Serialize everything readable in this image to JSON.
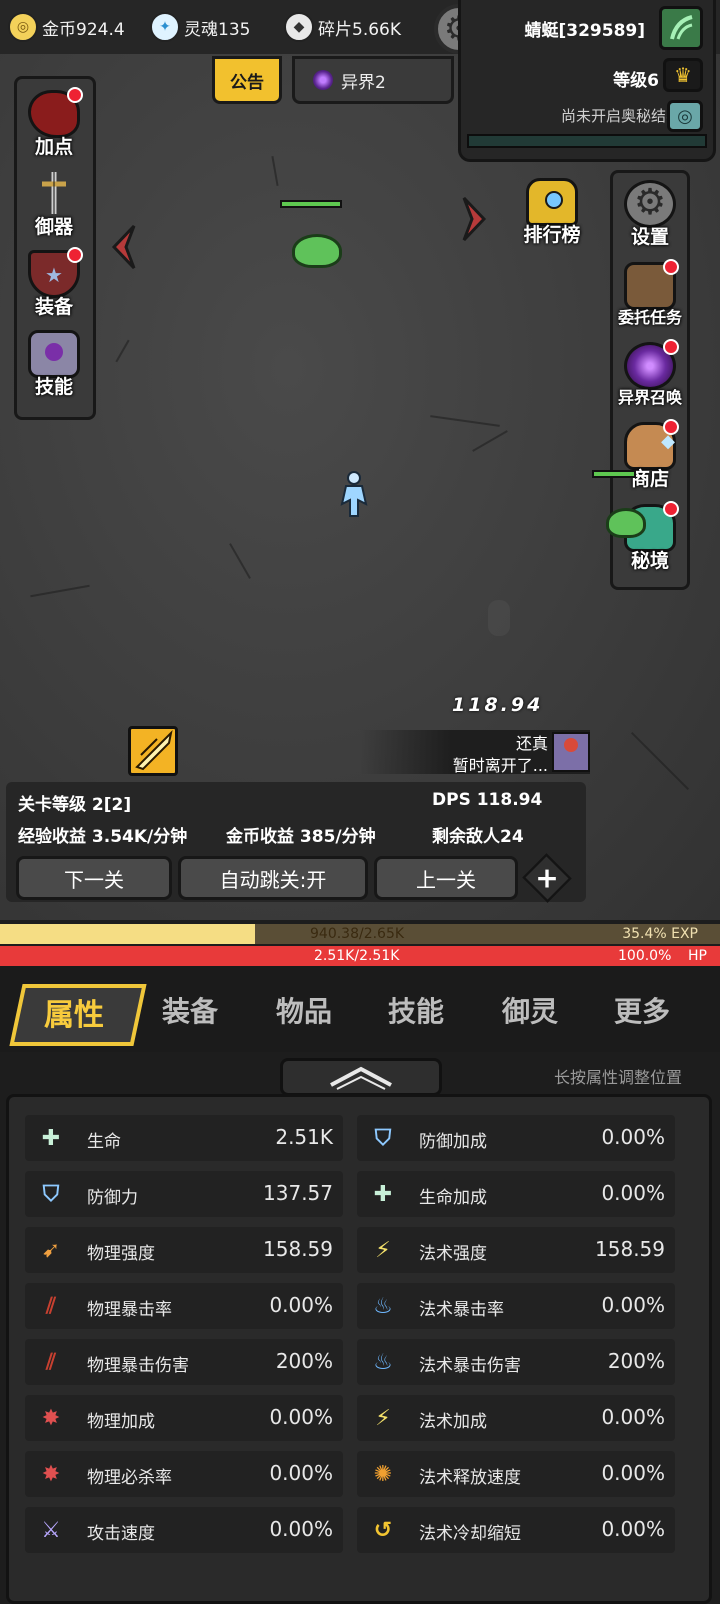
{
  "resources": {
    "gold": "金币924.4",
    "soul": "灵魂135",
    "shards": "碎片5.66K"
  },
  "player": {
    "name": "蜻蜓[329589]",
    "level": "等级6",
    "secret_realm_status": "尚未开启奥秘结界"
  },
  "tabs_top": {
    "notice": "公告",
    "realm": "异界2"
  },
  "left_menu": [
    {
      "label": "加点"
    },
    {
      "label": "御器"
    },
    {
      "label": "装备"
    },
    {
      "label": "技能"
    }
  ],
  "right_top_menu": [
    {
      "label": "排行榜"
    },
    {
      "label": "设置"
    }
  ],
  "right_menu": [
    {
      "label": "委托任务"
    },
    {
      "label": "异界召唤"
    },
    {
      "label": "商店"
    },
    {
      "label": "秘境"
    }
  ],
  "battle": {
    "damage_number": "118.94",
    "chat_name": "还真",
    "chat_message": "暂时离开了..."
  },
  "stage": {
    "level": "关卡等级 2[2]",
    "dps": "DPS 118.94",
    "exp_income": "经验收益 3.54K/分钟",
    "gold_income": "金币收益 385/分钟",
    "enemies_left": "剩余敌人24",
    "next_btn": "下一关",
    "auto_btn": "自动跳关:开",
    "prev_btn": "上一关",
    "plus": "+"
  },
  "bars": {
    "exp_text": "940.38/2.65K",
    "exp_percent": "35.4% EXP",
    "exp_fraction": 0.354,
    "hp_text": "2.51K/2.51K",
    "hp_percent": "100.0%",
    "hp_label": "HP"
  },
  "bottom_tabs": [
    "属性",
    "装备",
    "物品",
    "技能",
    "御灵",
    "更多"
  ],
  "attr_hint": "长按属性调整位置",
  "attributes_left": [
    {
      "icon": "plus-icon",
      "name": "生命",
      "value": "2.51K"
    },
    {
      "icon": "shield-icon",
      "name": "防御力",
      "value": "137.57"
    },
    {
      "icon": "blade-icon",
      "name": "物理强度",
      "value": "158.59"
    },
    {
      "icon": "claw-icon",
      "name": "物理暴击率",
      "value": "0.00%"
    },
    {
      "icon": "claw-icon",
      "name": "物理暴击伤害",
      "value": "200%"
    },
    {
      "icon": "burst-icon",
      "name": "物理加成",
      "value": "0.00%"
    },
    {
      "icon": "burst-icon",
      "name": "物理必杀率",
      "value": "0.00%"
    },
    {
      "icon": "sword-icon",
      "name": "攻击速度",
      "value": "0.00%"
    }
  ],
  "attributes_right": [
    {
      "icon": "shield-icon",
      "name": "防御加成",
      "value": "0.00%"
    },
    {
      "icon": "plus-icon",
      "name": "生命加成",
      "value": "0.00%"
    },
    {
      "icon": "lightning-icon",
      "name": "法术强度",
      "value": "158.59"
    },
    {
      "icon": "flame-icon",
      "name": "法术暴击率",
      "value": "0.00%"
    },
    {
      "icon": "flame-icon",
      "name": "法术暴击伤害",
      "value": "200%"
    },
    {
      "icon": "lightning-icon",
      "name": "法术加成",
      "value": "0.00%"
    },
    {
      "icon": "fire-orb-icon",
      "name": "法术释放速度",
      "value": "0.00%"
    },
    {
      "icon": "swirl-icon",
      "name": "法术冷却缩短",
      "value": "0.00%"
    }
  ],
  "colors": {
    "accent_gold": "#f0c73a",
    "exp_fill": "#f5dd84",
    "hp_fill": "#e83a3a",
    "slime_green": "#5fc25a"
  }
}
